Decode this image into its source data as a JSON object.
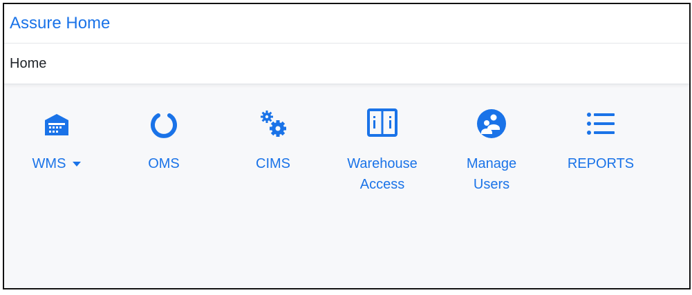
{
  "app": {
    "title": "Assure Home"
  },
  "breadcrumb": {
    "current": "Home"
  },
  "tiles": [
    {
      "label": "WMS",
      "icon": "warehouse-icon",
      "has_dropdown": true
    },
    {
      "label": "OMS",
      "icon": "circle-notch-icon"
    },
    {
      "label": "CIMS",
      "icon": "cogs-icon"
    },
    {
      "label_line1": "Warehouse",
      "label_line2": "Access",
      "icon": "cabinet-icon"
    },
    {
      "label_line1": "Manage",
      "label_line2": "Users",
      "icon": "users-circle-icon"
    },
    {
      "label": "REPORTS",
      "icon": "list-icon"
    }
  ],
  "colors": {
    "accent": "#1a73e8",
    "background": "#f7f8fa"
  }
}
